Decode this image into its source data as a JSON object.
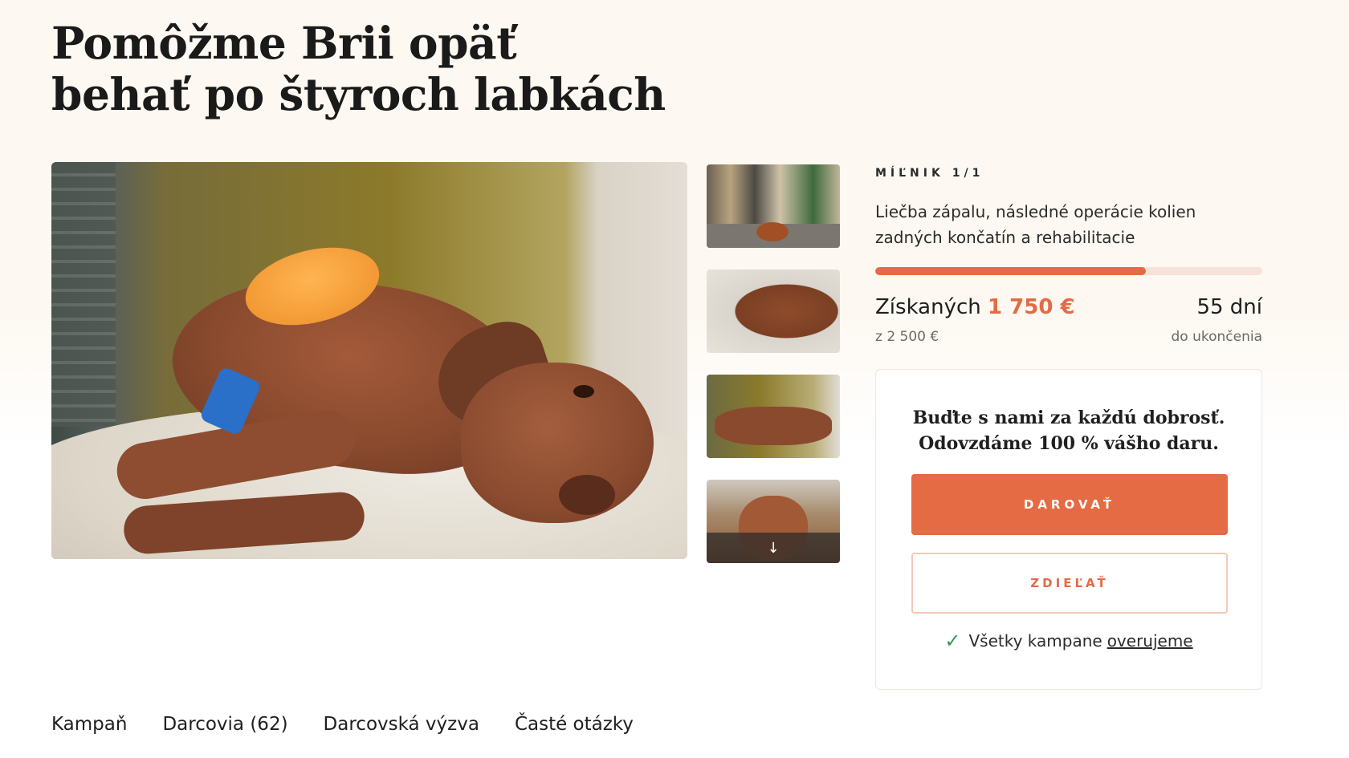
{
  "campaign": {
    "title_line1": "Pomôžme Brii opäť",
    "title_line2": "behať po štyroch labkách"
  },
  "gallery": {
    "scroll_icon": "arrow-down-icon",
    "scroll_glyph": "↓"
  },
  "milestone": {
    "label": "MÍĽNIK 1/1",
    "description": "Liečba zápalu, následné operácie kolien zadných končatín a rehabilitacie"
  },
  "progress": {
    "fraction": 0.7,
    "color": "#e46b44",
    "track_color": "#f6e2d8"
  },
  "stats": {
    "raised_label": "Získaných",
    "raised_amount": "1 750 €",
    "goal_text": "z  2 500 €",
    "days": "55 dní",
    "days_sub": "do ukončenia"
  },
  "cta": {
    "heading_line1": "Buďte s nami za každú dobrosť.",
    "heading_line2": "Odovzdáme 100 % vášho daru.",
    "donate_label": "DAROVAŤ",
    "share_label": "ZDIEĽAŤ",
    "verified_icon": "check-icon",
    "verified_text": "Všetky kampane",
    "verified_link": "overujeme"
  },
  "tabs": [
    {
      "label": "Kampaň"
    },
    {
      "label": "Darcovia (62)"
    },
    {
      "label": "Darcovská výzva"
    },
    {
      "label": "Časté otázky"
    }
  ],
  "colors": {
    "accent": "#e46b44",
    "background_top": "#fdf8f1",
    "check_green": "#2e9a52"
  }
}
